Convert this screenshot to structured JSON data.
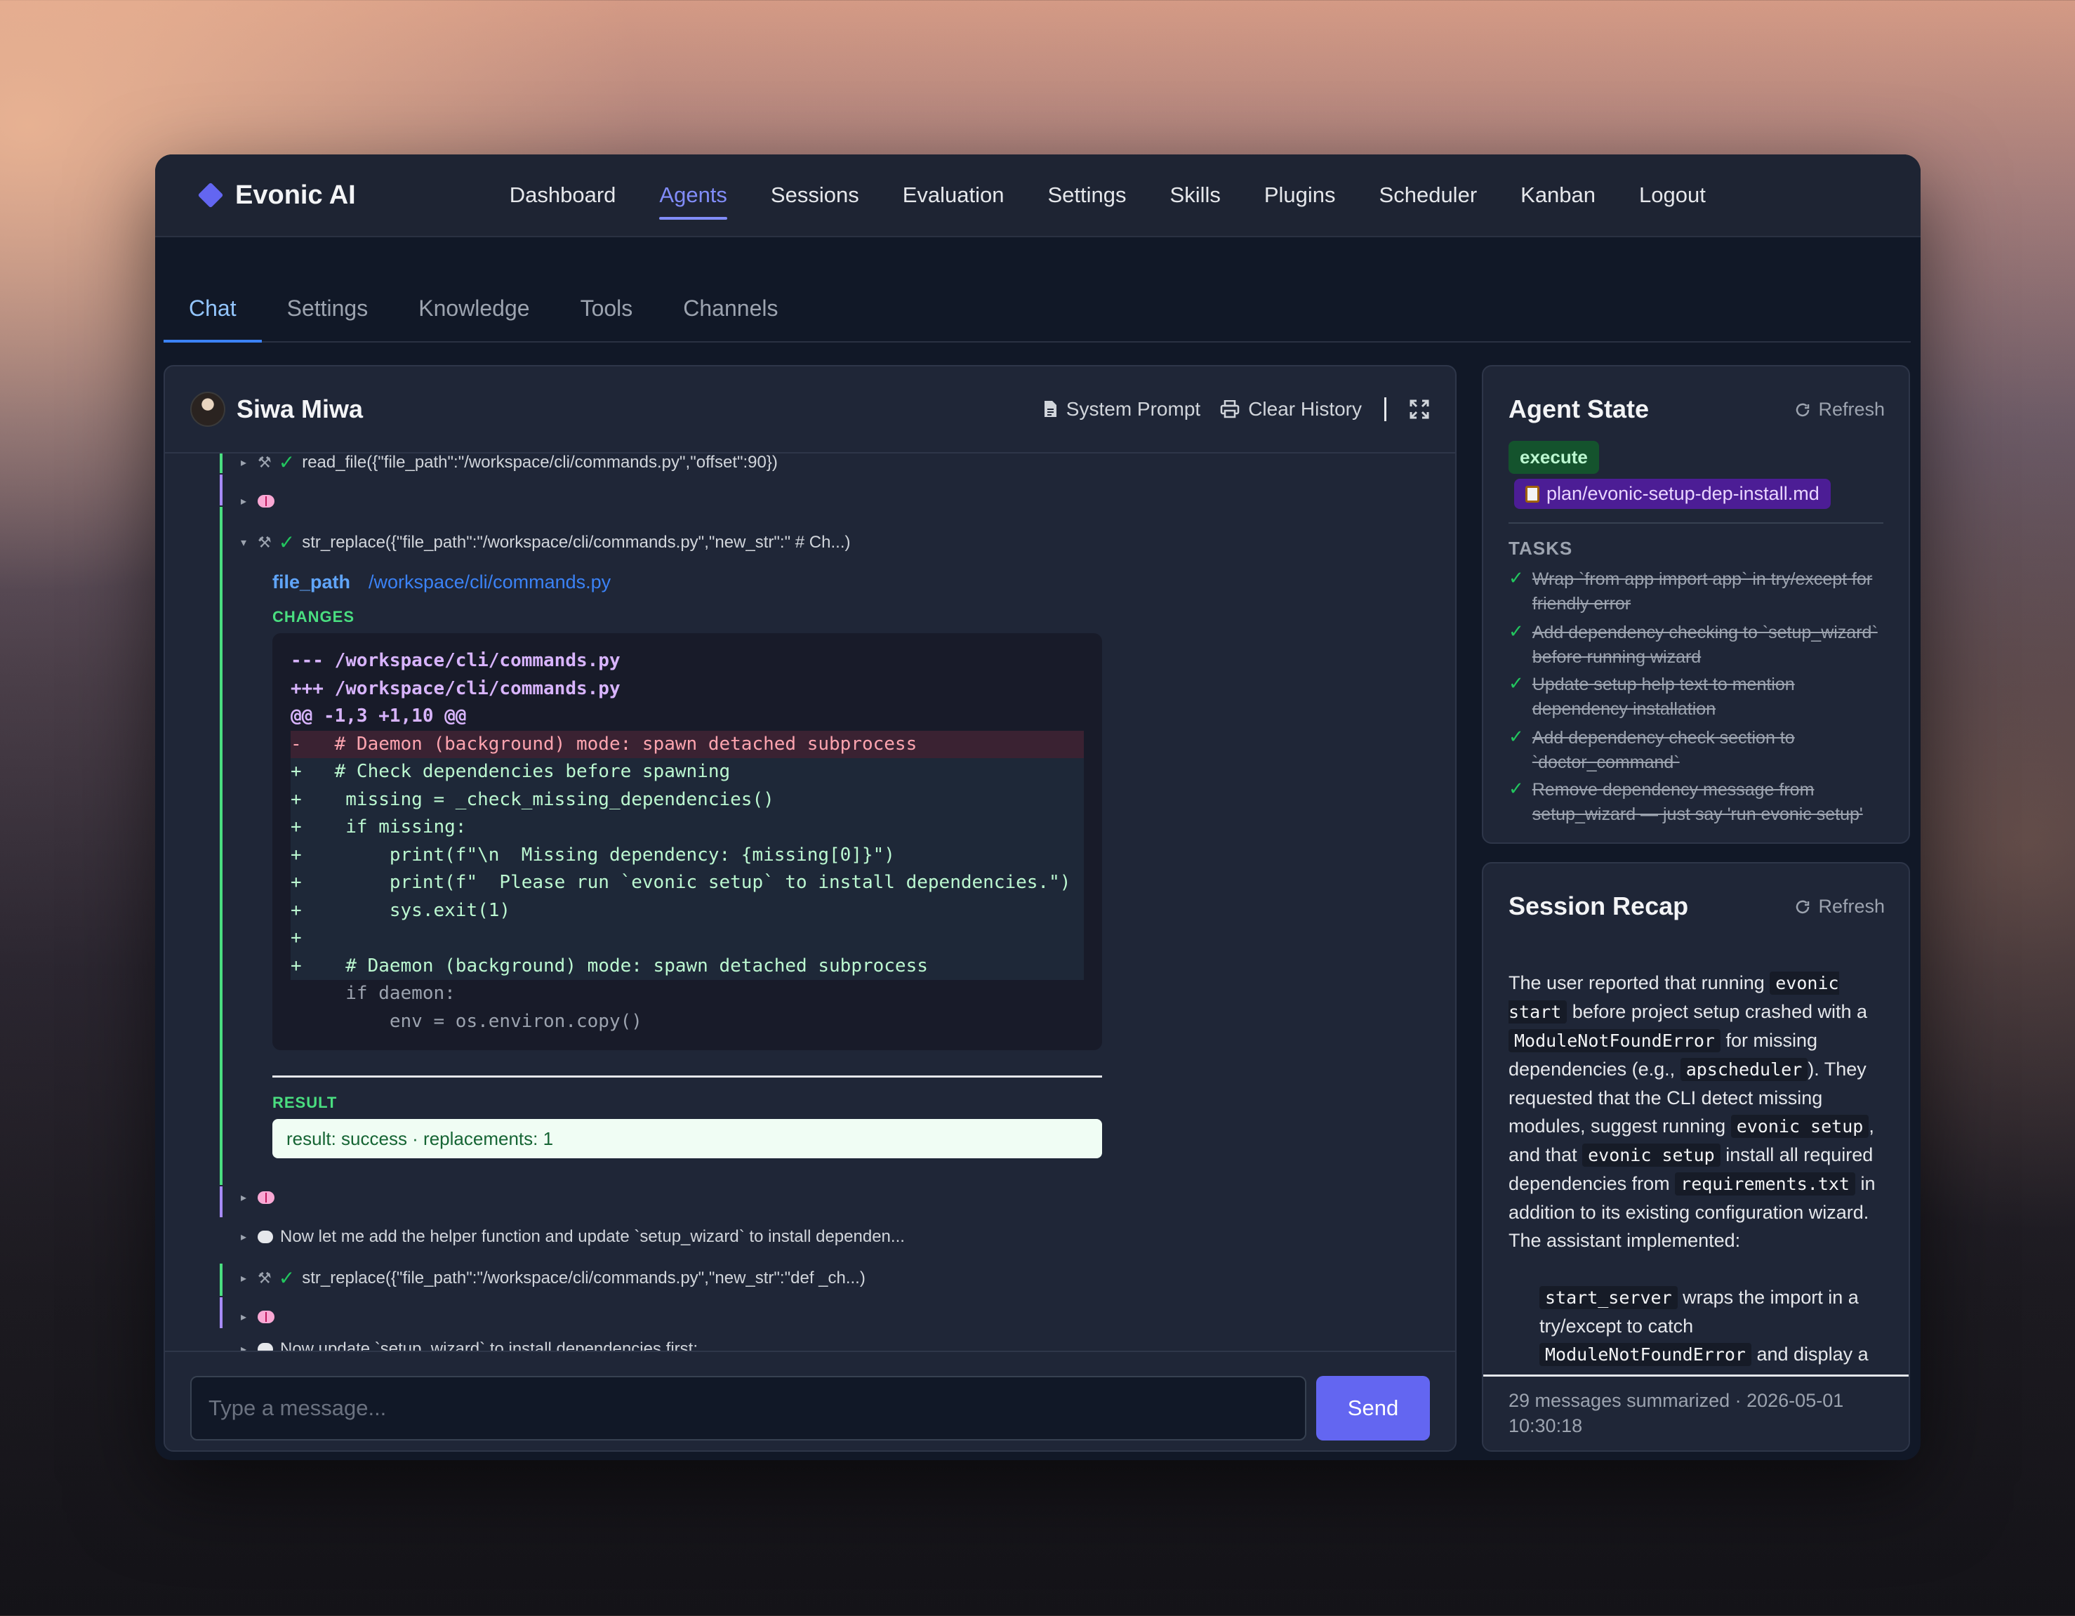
{
  "app": {
    "name": "Evonic AI"
  },
  "nav": {
    "links": [
      "Dashboard",
      "Agents",
      "Sessions",
      "Evaluation",
      "Settings",
      "Skills",
      "Plugins",
      "Scheduler",
      "Kanban",
      "Logout"
    ],
    "active": "Agents"
  },
  "subtabs": {
    "items": [
      "Chat",
      "Settings",
      "Knowledge",
      "Tools",
      "Channels"
    ],
    "active": "Chat"
  },
  "chat": {
    "agent_name": "Siwa Miwa",
    "system_prompt_label": "System Prompt",
    "clear_history_label": "Clear History",
    "messages": {
      "m1": "read_file({\"file_path\":\"/workspace/cli/commands.py\",\"offset\":90})",
      "m3": "str_replace({\"file_path\":\"/workspace/cli/commands.py\",\"new_str\":\" # Ch...)",
      "file_path_key": "file_path",
      "file_path_val": "/workspace/cli/commands.py",
      "changes_label": "CHANGES",
      "result_label": "RESULT",
      "result_text": "result: success · replacements: 1",
      "m6": "Now let me add the helper function and update `setup_wizard` to install dependen...",
      "m7": "str_replace({\"file_path\":\"/workspace/cli/commands.py\",\"new_str\":\"def _ch...)",
      "m9": "Now update `setup_wizard` to install dependencies first:"
    },
    "diff": [
      {
        "type": "hdr",
        "text": "--- /workspace/cli/commands.py"
      },
      {
        "type": "hdr",
        "text": "+++ /workspace/cli/commands.py"
      },
      {
        "type": "hdr",
        "text": "@@ -1,3 +1,10 @@"
      },
      {
        "type": "del",
        "text": "-   # Daemon (background) mode: spawn detached subprocess"
      },
      {
        "type": "add",
        "text": "+   # Check dependencies before spawning"
      },
      {
        "type": "add",
        "text": "+    missing = _check_missing_dependencies()"
      },
      {
        "type": "add",
        "text": "+    if missing:"
      },
      {
        "type": "add",
        "text": "+        print(f\"\\n  Missing dependency: {missing[0]}\")"
      },
      {
        "type": "add",
        "text": "+        print(f\"  Please run `evonic setup` to install dependencies.\")"
      },
      {
        "type": "add",
        "text": "+        sys.exit(1)"
      },
      {
        "type": "add",
        "text": "+"
      },
      {
        "type": "add",
        "text": "+    # Daemon (background) mode: spawn detached subprocess"
      },
      {
        "type": "ctx",
        "text": "     if daemon:"
      },
      {
        "type": "ctx",
        "text": "         env = os.environ.copy()"
      }
    ],
    "input_placeholder": "Type a message...",
    "send_label": "Send"
  },
  "agent_state": {
    "title": "Agent State",
    "refresh_label": "Refresh",
    "mode": "execute",
    "plan_file": "plan/evonic-setup-dep-install.md",
    "tasks_label": "TASKS",
    "tasks": [
      "Wrap `from app import app` in try/except for friendly error",
      "Add dependency checking to `setup_wizard` before running wizard",
      "Update setup help text to mention dependency installation",
      "Add dependency check section to `doctor_command`",
      "Remove dependency message from setup_wizard — just say 'run evonic setup'"
    ]
  },
  "recap": {
    "title": "Session Recap",
    "refresh_label": "Refresh",
    "footer": "29 messages summarized · 2026-05-01 10:30:18"
  },
  "colors": {
    "accent": "#6366f1",
    "active_nav": "#818cf8",
    "success": "#22c55e",
    "trace_green": "#4ade80",
    "trace_purple": "#a78bfa"
  }
}
